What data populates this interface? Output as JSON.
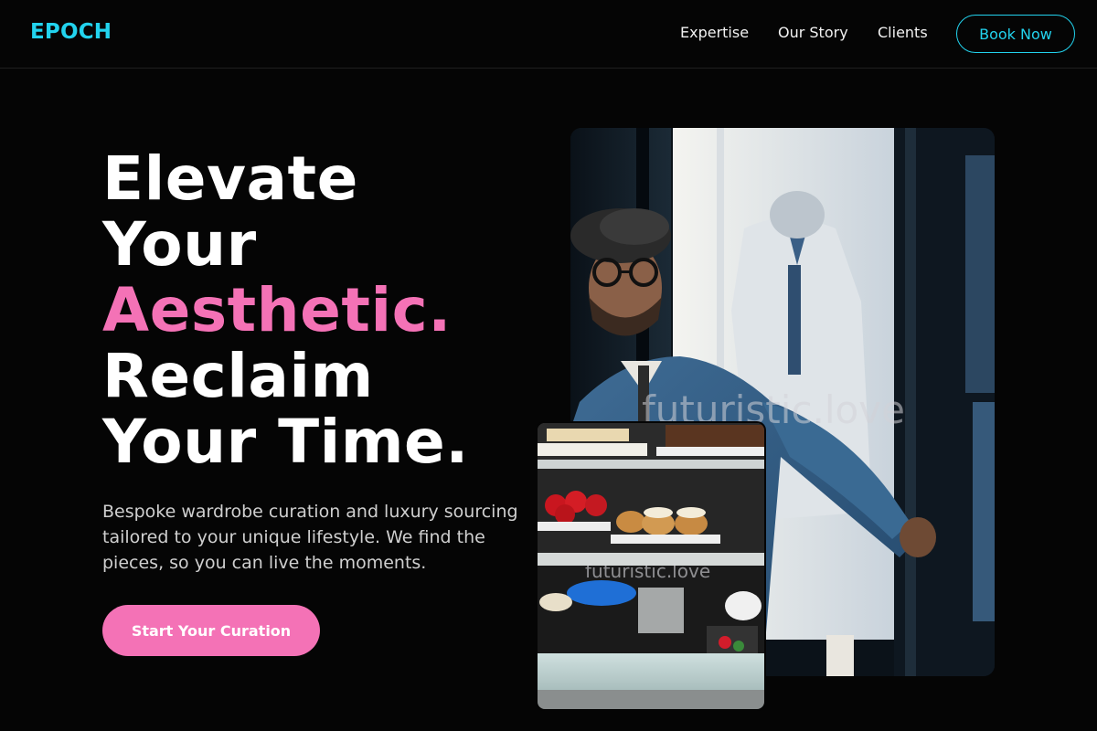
{
  "brand": {
    "name": "EPOCH",
    "color": "#22d3ee"
  },
  "nav": {
    "links": [
      "Expertise",
      "Our Story",
      "Clients"
    ],
    "cta_label": "Book Now"
  },
  "hero": {
    "title_lines": [
      "Elevate",
      "Your",
      "Aesthetic.",
      "Reclaim",
      "Your Time."
    ],
    "accent_line": "Aesthetic.",
    "accent_color": "#f472b6",
    "subtitle": "Bespoke wardrobe curation and luxury sourcing tailored to your unique lifestyle. We find the pieces, so you can live the moments.",
    "cta_label": "Start Your Curation"
  },
  "images": {
    "main": {
      "subject": "man-in-beret-at-boutique-door",
      "watermark": "futuristic.love"
    },
    "secondary": {
      "subject": "pastry-display-case",
      "watermark": "futuristic.love"
    }
  }
}
